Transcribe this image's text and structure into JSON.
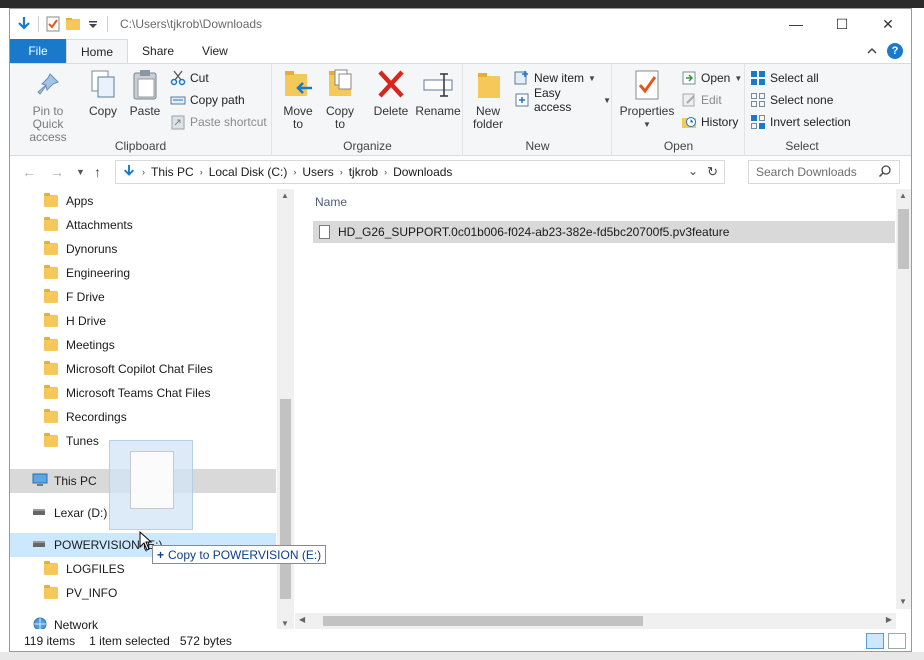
{
  "window": {
    "path": "C:\\Users\\tjkrob\\Downloads",
    "controls": {
      "minimize": "—",
      "maximize": "☐",
      "close": "✕"
    }
  },
  "ribbon_tabs": {
    "file": "File",
    "home": "Home",
    "share": "Share",
    "view": "View"
  },
  "ribbon": {
    "clipboard": {
      "label": "Clipboard",
      "pin": "Pin to Quick access",
      "pin_l1": "Pin to Quick",
      "pin_l2": "access",
      "copy": "Copy",
      "paste": "Paste",
      "cut": "Cut",
      "copy_path": "Copy path",
      "paste_shortcut": "Paste shortcut"
    },
    "organize": {
      "label": "Organize",
      "move_l1": "Move",
      "move_l2": "to",
      "copy_l1": "Copy",
      "copy_l2": "to",
      "delete": "Delete",
      "rename": "Rename"
    },
    "new": {
      "label": "New",
      "folder_l1": "New",
      "folder_l2": "folder",
      "new_item": "New item",
      "easy_access": "Easy access"
    },
    "open": {
      "label": "Open",
      "properties": "Properties",
      "open": "Open",
      "edit": "Edit",
      "history": "History"
    },
    "select": {
      "label": "Select",
      "select_all": "Select all",
      "select_none": "Select none",
      "invert": "Invert selection"
    }
  },
  "address": {
    "crumbs": [
      "This PC",
      "Local Disk (C:)",
      "Users",
      "tjkrob",
      "Downloads"
    ],
    "search_placeholder": "Search Downloads"
  },
  "nav": {
    "folders": [
      "Apps",
      "Attachments",
      "Dynoruns",
      "Engineering",
      "F Drive",
      "H Drive",
      "Meetings",
      "Microsoft Copilot Chat Files",
      "Microsoft Teams Chat Files",
      "Recordings",
      "Tunes"
    ],
    "this_pc": "This PC",
    "lexar": "Lexar (D:)",
    "powervision": "POWERVISION (E:)",
    "pv_children": [
      "LOGFILES",
      "PV_INFO"
    ],
    "network": "Network"
  },
  "content": {
    "column_name": "Name",
    "file_name": "HD_G26_SUPPORT.0c01b006-f024-ab23-382e-fd5bc20700f5.pv3feature"
  },
  "drag": {
    "tooltip_plus": "+",
    "tooltip_text": "Copy to POWERVISION (E:)"
  },
  "status": {
    "items": "119 items",
    "selected": "1 item selected",
    "size": "572 bytes"
  },
  "colors": {
    "accent": "#1979ca",
    "selection": "#d9d9d9",
    "hover": "#cce8ff",
    "folder": "#f5c85a"
  }
}
